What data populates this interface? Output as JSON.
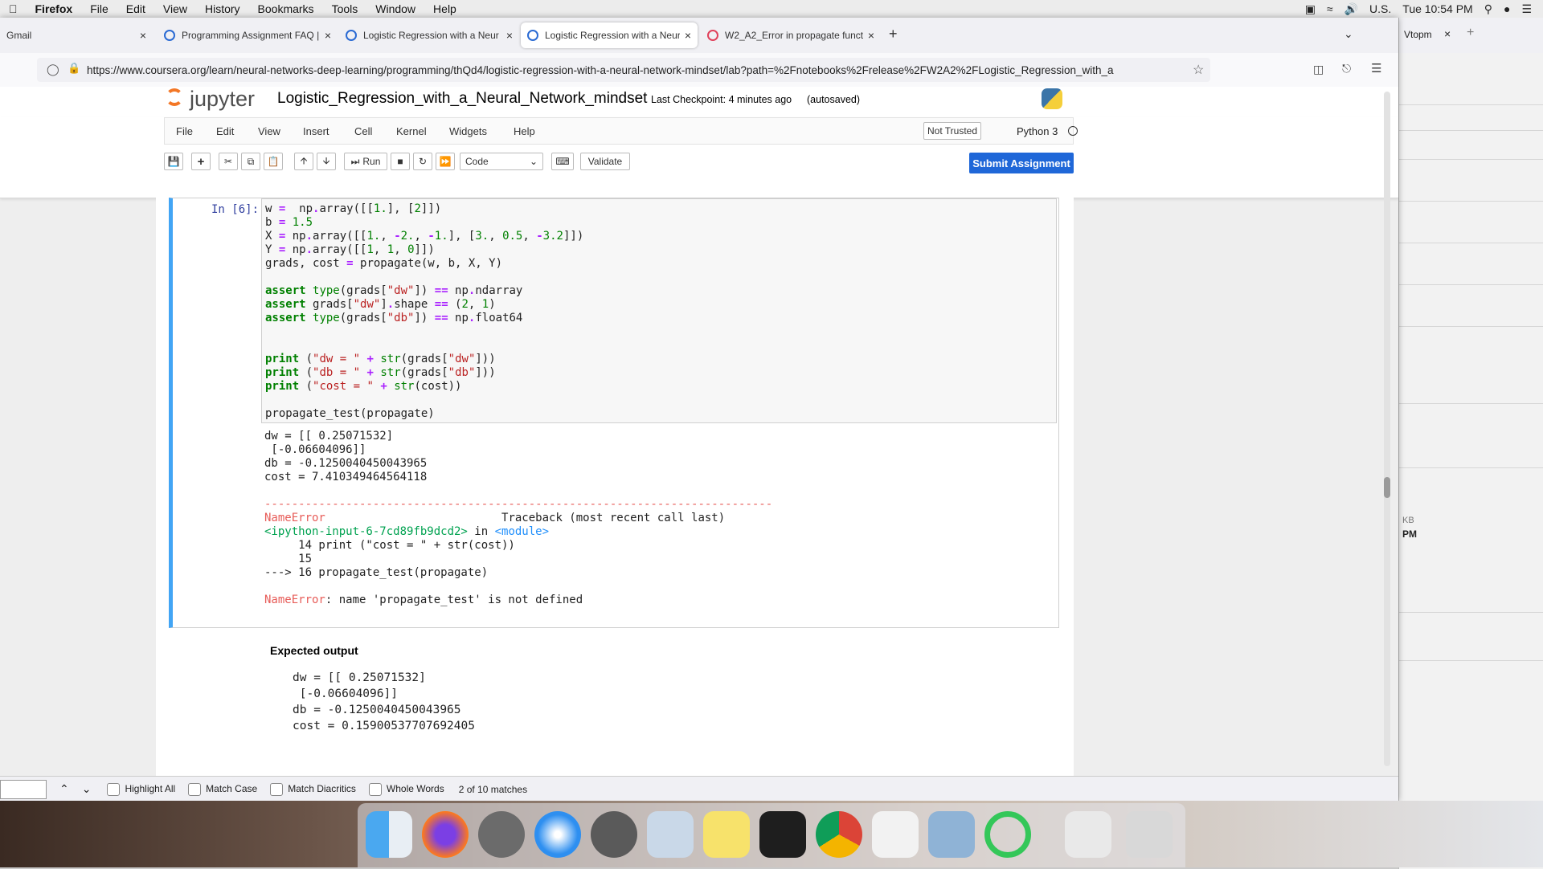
{
  "menubar": {
    "app": "Firefox",
    "items": [
      "File",
      "Edit",
      "View",
      "History",
      "Bookmarks",
      "Tools",
      "Window",
      "Help"
    ],
    "input_source": "U.S.",
    "clock": "Tue 10:54 PM"
  },
  "tabs": [
    {
      "title": "Gmail"
    },
    {
      "title": "Programming Assignment FAQ |"
    },
    {
      "title": "Logistic Regression with a Neur"
    },
    {
      "title": "Logistic Regression with a Neur"
    },
    {
      "title": "W2_A2_Error in propagate funct"
    }
  ],
  "bg_window_tab": "Vtopm",
  "url": "https://www.coursera.org/learn/neural-networks-deep-learning/programming/thQd4/logistic-regression-with-a-neural-network-mindset/lab?path=%2Fnotebooks%2Frelease%2FW2A2%2FLogistic_Regression_with_a",
  "jupyter": {
    "logo_text": "jupyter",
    "notebook_name": "Logistic_Regression_with_a_Neural_Network_mindset",
    "checkpoint": "Last Checkpoint: 4 minutes ago",
    "autosaved": "(autosaved)",
    "menu": [
      "File",
      "Edit",
      "View",
      "Insert",
      "Cell",
      "Kernel",
      "Widgets",
      "Help"
    ],
    "trust": "Not Trusted",
    "kernel": "Python 3",
    "run_label": "Run",
    "cell_type": "Code",
    "validate_label": "Validate",
    "submit_label": "Submit Assignment"
  },
  "cell": {
    "prompt": "In [6]:",
    "output_lines": [
      "dw = [[ 0.25071532]",
      " [-0.06604096]]",
      "db = -0.1250040450043965",
      "cost = 7.410349464564118"
    ],
    "traceback": {
      "rule": "---------------------------------------------------------------------------",
      "error_name": "NameError",
      "header_right": "Traceback (most recent call last)",
      "input_ref": "<ipython-input-6-7cd89fb9dcd2>",
      "in_word": " in ",
      "module": "<module>",
      "line14": "     14 print (\"cost = \" + str(cost))",
      "line15": "     15",
      "arrow": "---> 16 propagate_test(propagate)",
      "message": ": name 'propagate_test' is not defined"
    }
  },
  "expected": {
    "heading": "Expected output",
    "lines": [
      "dw = [[ 0.25071532]",
      " [-0.06604096]]",
      "db = -0.1250040450043965",
      "cost = 0.15900537707692405"
    ]
  },
  "findbar": {
    "highlight_all": "Highlight All",
    "match_case": "Match Case",
    "match_diacritics": "Match Diacritics",
    "whole_words": "Whole Words",
    "status": "2 of 10 matches"
  },
  "bg_window_text": {
    "kb": "KB",
    "pm": "PM"
  }
}
